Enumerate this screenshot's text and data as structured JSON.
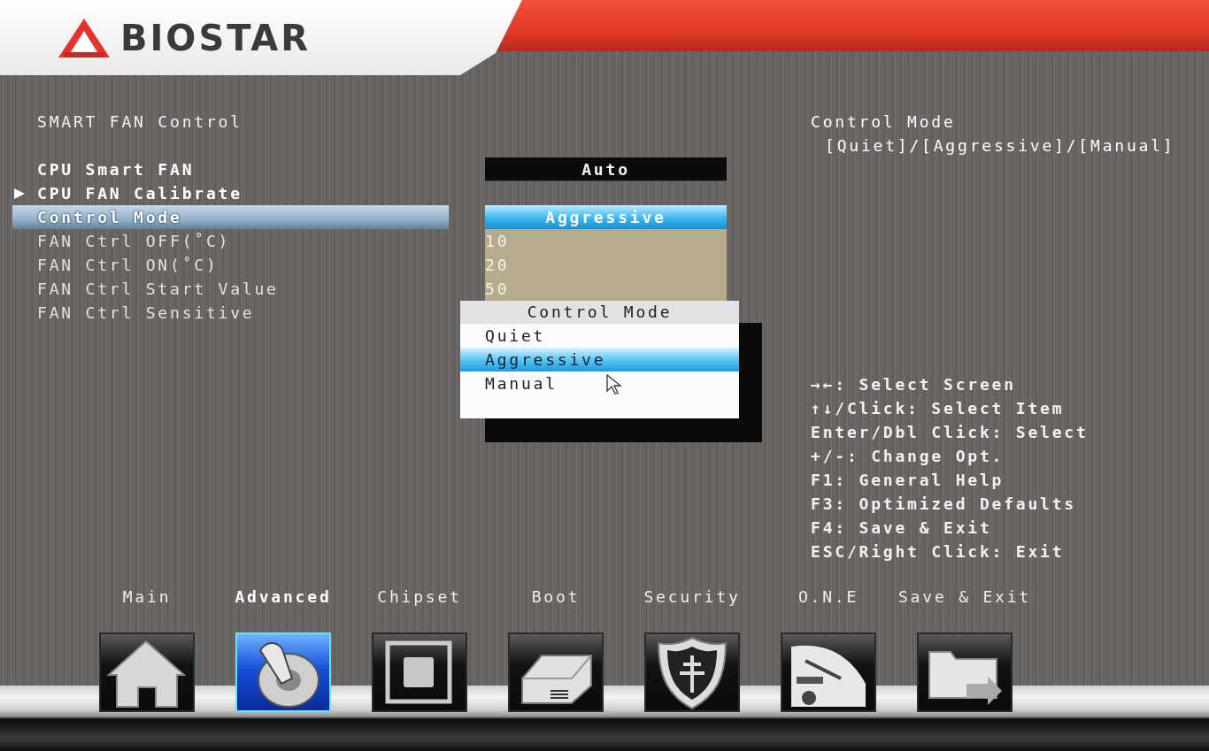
{
  "brand": {
    "name": "BIOSTAR"
  },
  "page_title": "SMART FAN Control",
  "items": [
    {
      "label": "CPU Smart FAN",
      "kind": "setting",
      "selected": false,
      "disabled": false,
      "value": "Auto"
    },
    {
      "label": "CPU FAN Calibrate",
      "kind": "submenu",
      "selected": false,
      "disabled": false
    },
    {
      "label": "Control Mode",
      "kind": "setting",
      "selected": true,
      "disabled": false,
      "value": "Aggressive"
    },
    {
      "label": "FAN Ctrl OFF(˚C)",
      "kind": "setting",
      "selected": false,
      "disabled": true,
      "value": "10"
    },
    {
      "label": "FAN Ctrl ON(˚C)",
      "kind": "setting",
      "selected": false,
      "disabled": true,
      "value": "20"
    },
    {
      "label": "FAN Ctrl Start Value",
      "kind": "setting",
      "selected": false,
      "disabled": true,
      "value": "50"
    },
    {
      "label": "FAN Ctrl Sensitive",
      "kind": "setting",
      "selected": false,
      "disabled": true
    }
  ],
  "popup": {
    "title": "Control Mode",
    "options": [
      {
        "label": "Quiet",
        "selected": false
      },
      {
        "label": "Aggressive",
        "selected": true
      },
      {
        "label": "Manual",
        "selected": false
      }
    ]
  },
  "help": {
    "title": "Control Mode",
    "text": "[Quiet]/[Aggressive]/[Manual]",
    "keys": [
      "→←: Select Screen",
      "↑↓/Click: Select Item",
      "Enter/Dbl Click: Select",
      "+/-: Change Opt.",
      "F1: General Help",
      "F3: Optimized Defaults",
      "F4: Save & Exit",
      "ESC/Right Click: Exit"
    ]
  },
  "tabs": [
    {
      "label": "Main",
      "kind": "house",
      "selected": false
    },
    {
      "label": "Advanced",
      "kind": "switch",
      "selected": true
    },
    {
      "label": "Chipset",
      "kind": "chip",
      "selected": false
    },
    {
      "label": "Boot",
      "kind": "drive",
      "selected": false
    },
    {
      "label": "Security",
      "kind": "shield",
      "selected": false
    },
    {
      "label": "O.N.E",
      "kind": "gauge",
      "selected": false
    },
    {
      "label": "Save & Exit",
      "kind": "folder",
      "selected": false
    }
  ]
}
